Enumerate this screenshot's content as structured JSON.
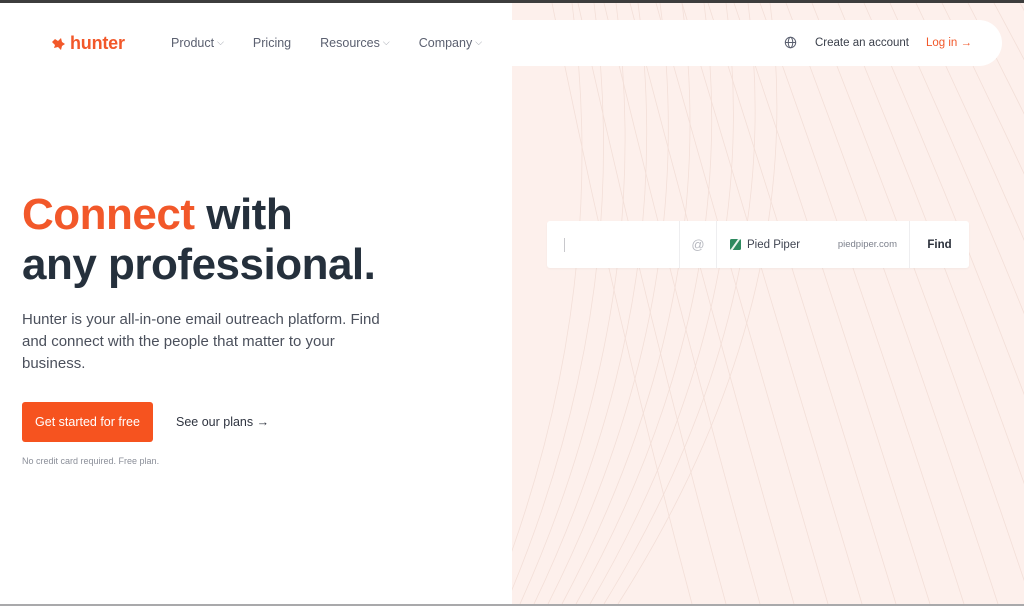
{
  "brand": {
    "name": "hunter",
    "accent_color": "#f2582a"
  },
  "nav": {
    "items": [
      {
        "label": "Product",
        "has_dropdown": true
      },
      {
        "label": "Pricing",
        "has_dropdown": false
      },
      {
        "label": "Resources",
        "has_dropdown": true
      },
      {
        "label": "Company",
        "has_dropdown": true
      }
    ],
    "language_icon": "globe-icon",
    "create_account": "Create an account",
    "login": "Log in →"
  },
  "hero": {
    "headline_accent": "Connect",
    "headline_rest_1": " with",
    "headline_line_2": "any professional.",
    "subtitle": "Hunter is your all-in-one email outreach platform. Find and connect with the people that matter to your business.",
    "cta_primary": "Get started for free",
    "cta_secondary": "See our plans →",
    "note": "No credit card required. Free plan."
  },
  "search_widget": {
    "name_value": "",
    "at_symbol": "@",
    "company_name": "Pied Piper",
    "company_domain": "piedpiper.com",
    "find_label": "Find"
  },
  "colors": {
    "primary_button": "#f6531f",
    "right_panel_bg": "#fdf0ec",
    "company_icon": "#2d8a5f"
  }
}
